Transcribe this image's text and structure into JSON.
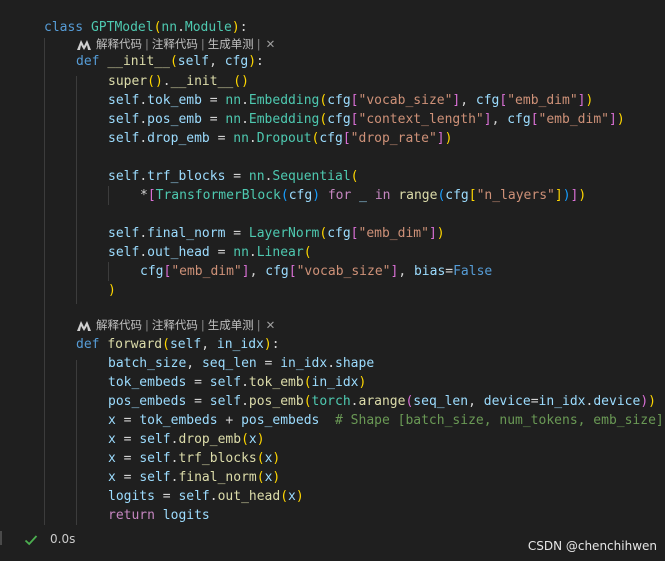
{
  "code_lens": {
    "explain": "解释代码",
    "comment": "注释代码",
    "unittest": "生成单测",
    "separator": "|",
    "close": "✕"
  },
  "tokens": {
    "class": "class",
    "def": "def",
    "for": "for",
    "in": "in",
    "return": "return",
    "GPTModel": "GPTModel",
    "nn": "nn",
    "Module": "Module",
    "init": "__init__",
    "self": "self",
    "cfg": "cfg",
    "super": "super",
    "tok_emb": "tok_emb",
    "pos_emb": "pos_emb",
    "drop_emb": "drop_emb",
    "trf_blocks": "trf_blocks",
    "final_norm": "final_norm",
    "out_head": "out_head",
    "Embedding": "Embedding",
    "Dropout": "Dropout",
    "Sequential": "Sequential",
    "TransformerBlock": "TransformerBlock",
    "range": "range",
    "LayerNorm": "LayerNorm",
    "Linear": "Linear",
    "bias": "bias",
    "False": "False",
    "underscore": "_",
    "forward": "forward",
    "in_idx": "in_idx",
    "batch_size": "batch_size",
    "seq_len": "seq_len",
    "shape": "shape",
    "tok_embeds": "tok_embeds",
    "pos_embeds": "pos_embeds",
    "torch": "torch",
    "arange": "arange",
    "device": "device",
    "x": "x",
    "logits": "logits",
    "s_vocab_size": "\"vocab_size\"",
    "s_emb_dim": "\"emb_dim\"",
    "s_context_length": "\"context_length\"",
    "s_drop_rate": "\"drop_rate\"",
    "s_n_layers": "\"n_layers\"",
    "comment_shape": "# Shape [batch_size, num_tokens, emb_size]"
  },
  "status": {
    "elapsed": "0.0s",
    "watermark": "CSDN @chenchihwen"
  },
  "colors": {
    "background": "#1f1f1f",
    "keyword": "#569cd6",
    "control_keyword": "#c586c0",
    "class_name": "#4ec9b0",
    "function": "#dcdcaa",
    "variable": "#9cdcfe",
    "string": "#ce9178",
    "comment": "#6a9955",
    "success": "#4caf50"
  }
}
